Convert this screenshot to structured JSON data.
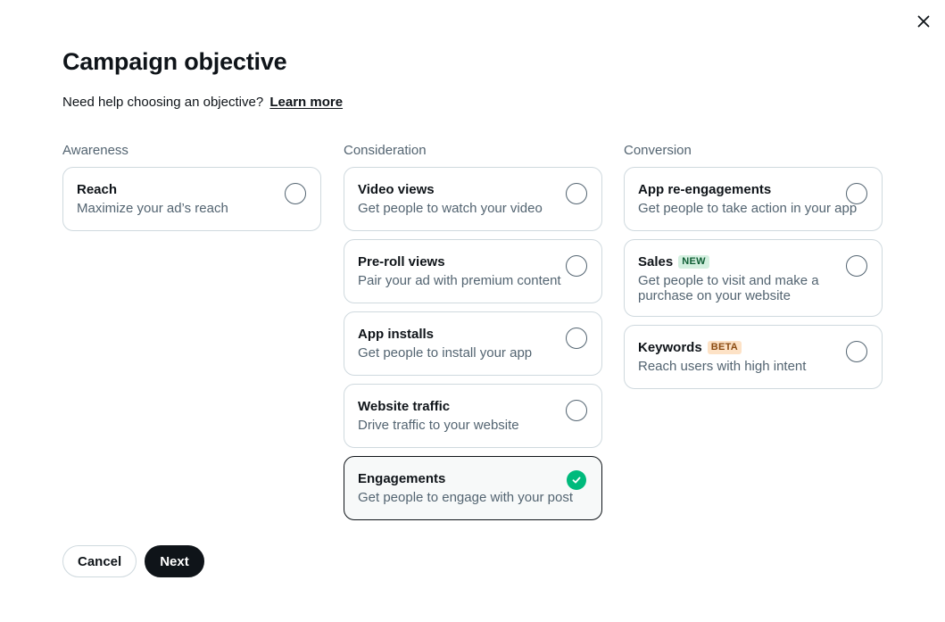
{
  "dialog": {
    "title": "Campaign objective",
    "help_text": "Need help choosing an objective?",
    "help_link": "Learn more",
    "close_icon": "close-icon"
  },
  "columns": {
    "awareness": {
      "header": "Awareness",
      "options": [
        {
          "title": "Reach",
          "description": "Maximize your ad’s reach",
          "selected": false
        }
      ]
    },
    "consideration": {
      "header": "Consideration",
      "options": [
        {
          "title": "Video views",
          "description": "Get people to watch your video",
          "selected": false
        },
        {
          "title": "Pre-roll views",
          "description": "Pair your ad with premium content",
          "selected": false
        },
        {
          "title": "App installs",
          "description": "Get people to install your app",
          "selected": false
        },
        {
          "title": "Website traffic",
          "description": "Drive traffic to your website",
          "selected": false
        },
        {
          "title": "Engagements",
          "description": "Get people to engage with your post",
          "selected": true
        }
      ]
    },
    "conversion": {
      "header": "Conversion",
      "options": [
        {
          "title": "App re-engagements",
          "description": "Get people to take action in your app",
          "selected": false
        },
        {
          "title": "Sales",
          "badge": "NEW",
          "description": "Get people to visit and make a purchase on your website",
          "selected": false
        },
        {
          "title": "Keywords",
          "badge": "BETA",
          "description": "Reach users with high intent",
          "selected": false
        }
      ]
    }
  },
  "footer": {
    "cancel_label": "Cancel",
    "next_label": "Next"
  },
  "colors": {
    "text": "#0f1419",
    "secondary_text": "#536471",
    "border": "#cfd9de",
    "selected_check": "#00ba7c",
    "new_badge_bg": "#d4f0e0",
    "beta_badge_bg": "#fde2c6"
  }
}
